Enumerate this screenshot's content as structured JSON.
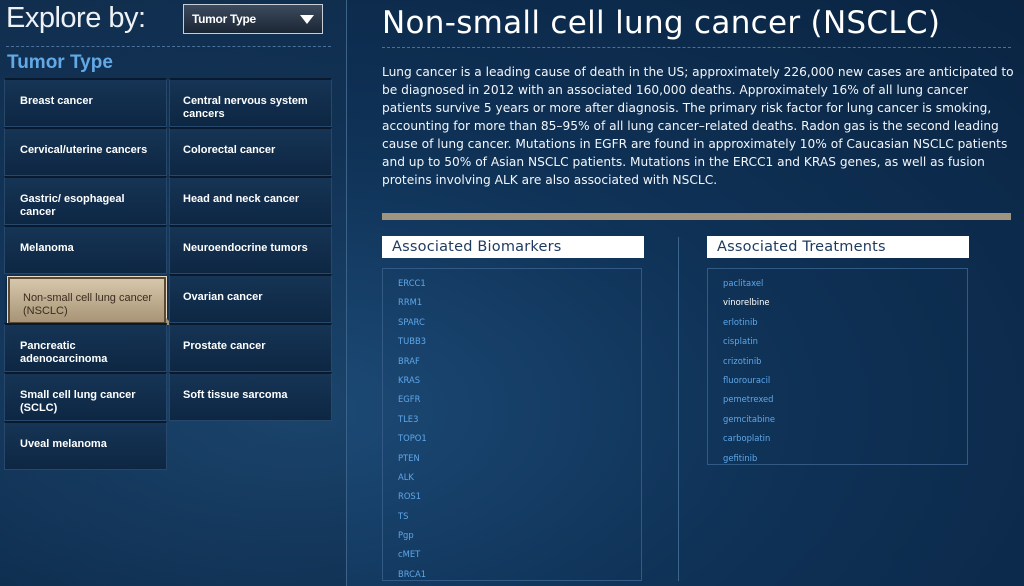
{
  "explore": {
    "label": "Explore by:",
    "dropdown_value": "Tumor Type"
  },
  "sidebar": {
    "section_title": "Tumor Type",
    "items": [
      {
        "label": "Breast cancer"
      },
      {
        "label": "Central nervous system cancers"
      },
      {
        "label": "Cervical/uterine cancers"
      },
      {
        "label": "Colorectal cancer"
      },
      {
        "label": "Gastric/ esophageal cancer"
      },
      {
        "label": "Head and neck cancer"
      },
      {
        "label": "Melanoma"
      },
      {
        "label": "Neuroendocrine tumors"
      },
      {
        "label": "Non-small cell lung cancer (NSCLC)"
      },
      {
        "label": "Ovarian cancer"
      },
      {
        "label": "Pancreatic adenocarcinoma"
      },
      {
        "label": "Prostate cancer"
      },
      {
        "label": "Small cell lung cancer (SCLC)"
      },
      {
        "label": "Soft tissue sarcoma"
      },
      {
        "label": "Uveal melanoma"
      }
    ],
    "active_index": 8
  },
  "main": {
    "title": "Non-small cell lung cancer (NSCLC)",
    "description": "Lung cancer is a leading cause of death in the US; approximately 226,000 new cases are anticipated to be diagnosed in 2012 with an associated 160,000 deaths. Approximately 16% of all lung cancer patients survive 5 years or more after diagnosis. The primary risk factor for lung cancer is smoking, accounting for more than 85–95% of all lung cancer–related deaths. Radon gas is the second leading cause of lung cancer. Mutations in EGFR are found in approximately 10% of Caucasian NSCLC patients and up to 50% of Asian NSCLC patients. Mutations in the ERCC1 and KRAS genes, as well as fusion proteins involving ALK are also associated with NSCLC.",
    "biomarkers": {
      "header": "Associated Biomarkers",
      "items": [
        "ERCC1",
        "RRM1",
        "SPARC",
        "TUBB3",
        "BRAF",
        "KRAS",
        "EGFR",
        "TLE3",
        "TOPO1",
        "PTEN",
        "ALK",
        "ROS1",
        "TS",
        "Pgp",
        "cMET",
        "BRCA1"
      ]
    },
    "treatments": {
      "header": "Associated Treatments",
      "items": [
        "paclitaxel",
        "vinorelbine",
        "erlotinib",
        "cisplatin",
        "crizotinib",
        "fluorouracil",
        "pemetrexed",
        "gemcitabine",
        "carboplatin",
        "gefitinib"
      ],
      "highlighted_index": 1
    }
  },
  "colors": {
    "background": "#0c2a4a",
    "section_title": "#63a9e6",
    "link": "#5ea7ea",
    "active_tab": "#c9b899",
    "divider_bar": "#a09380"
  }
}
